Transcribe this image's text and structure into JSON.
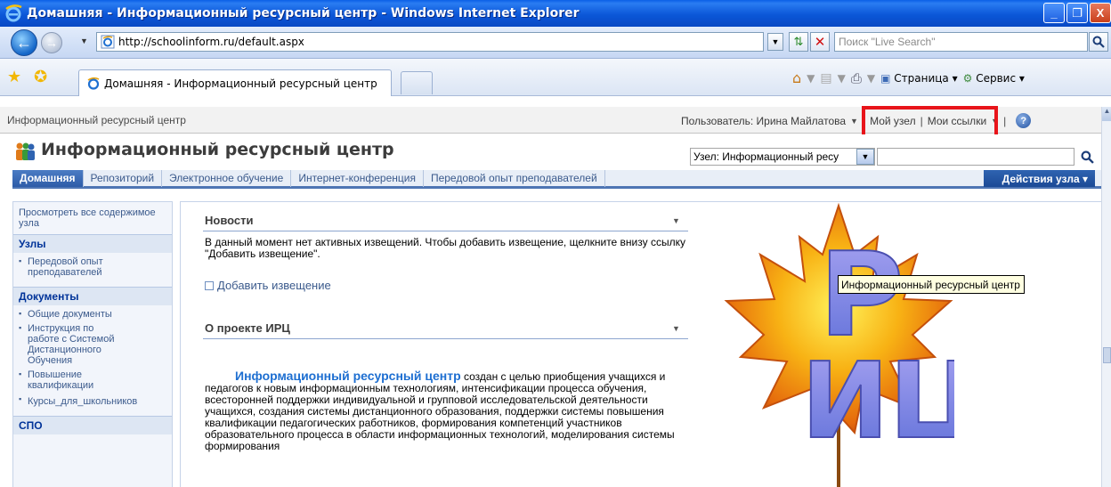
{
  "window": {
    "title": "Домашняя - Информационный ресурсный центр - Windows Internet Explorer",
    "minimize": "_",
    "maximize": "❐",
    "close": "X"
  },
  "address": {
    "url": "http://schoolinform.ru/default.aspx",
    "search_placeholder": "Поиск \"Live Search\""
  },
  "favorites": {
    "tab_title": "Домашняя - Информационный ресурсный центр"
  },
  "command_bar": {
    "page_label": "Страница",
    "tools_label": "Сервис"
  },
  "sp_top": {
    "site_crumb": "Информационный ресурсный центр",
    "user_label": "Пользователь: Ирина Майлатова",
    "my_site": "Мой узел",
    "my_links": "Мои ссылки",
    "separator": "|"
  },
  "sp_header": {
    "site_title": "Информационный ресурсный центр",
    "scope": "Узел: Информационный ресу"
  },
  "topnav": {
    "items": [
      "Домашняя",
      "Репозиторий",
      "Электронное обучение",
      "Интернет-конференция",
      "Передовой опыт преподавателей"
    ],
    "site_actions": "Действия узла ▾"
  },
  "left_nav": {
    "view_all": "Просмотреть все содержимое узла",
    "sites_head": "Узлы",
    "sites_items": [
      "Передовой опыт преподавателей"
    ],
    "docs_head": "Документы",
    "docs_items": [
      "Общие документы",
      "Инструкция по работе с Системой Дистанционного Обучения",
      "Повышение квалификации",
      "Курсы_для_школьников"
    ],
    "spo_head": "СПО"
  },
  "news": {
    "title": "Новости",
    "empty_text": "В данный момент нет активных извещений. Чтобы добавить извещение, щелкните внизу ссылку \"Добавить извещение\".",
    "add_link": "Добавить извещение"
  },
  "about": {
    "title": "О проекте ИРЦ",
    "highlight": "Информационный ресурсный центр",
    "body": " создан с целью приобщения учащихся и педагогов к новым информационным технологиям, интенсификации процесса обучения, всесторонней поддержки индивидуальной и групповой исследовательской деятельности учащихся, создания системы дистанционного образования, поддержки системы повышения квалификации педагогических работников, формирования компетенций участников образовательного процесса в области информационных технологий, моделирования системы формирования"
  },
  "logo": {
    "letter_r": "Р",
    "letters_ic": "ИЦ"
  },
  "tooltip": "Информационный ресурсный центр",
  "colors": {
    "title_bar": "#0b57d8",
    "highlight_box": "#e8141a",
    "sp_link": "#3b5a8c",
    "sp_accent": "#2e5ca8"
  }
}
